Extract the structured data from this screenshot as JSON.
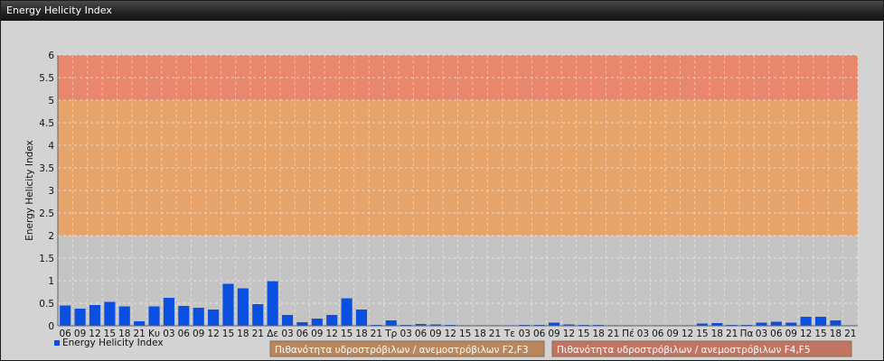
{
  "window": {
    "title": "Energy Helicity Index"
  },
  "chart_data": {
    "type": "bar",
    "ylabel": "Energy Helicity Index",
    "ylim": [
      0,
      6
    ],
    "y_ticks": [
      "0",
      "0.5",
      "1",
      "1.5",
      "2",
      "2.5",
      "3",
      "3.5",
      "4",
      "4.5",
      "5",
      "5.5",
      "6"
    ],
    "grid": true,
    "categories": [
      "06",
      "09",
      "12",
      "15",
      "18",
      "21",
      "Κυ",
      "03",
      "06",
      "09",
      "12",
      "15",
      "18",
      "21",
      "Δε",
      "03",
      "06",
      "09",
      "12",
      "15",
      "18",
      "21",
      "Τρ",
      "03",
      "06",
      "09",
      "12",
      "15",
      "18",
      "21",
      "Τε",
      "03",
      "06",
      "09",
      "12",
      "15",
      "18",
      "21",
      "Πέ",
      "03",
      "06",
      "09",
      "12",
      "15",
      "18",
      "21",
      "Πα",
      "03",
      "06",
      "09",
      "12",
      "15",
      "18",
      "21"
    ],
    "series": [
      {
        "name": "Energy Helicity Index",
        "values": [
          0.45,
          0.38,
          0.46,
          0.53,
          0.43,
          0.1,
          0.43,
          0.62,
          0.44,
          0.4,
          0.36,
          0.93,
          0.83,
          0.48,
          0.99,
          0.24,
          0.08,
          0.16,
          0.24,
          0.61,
          0.36,
          0.02,
          0.12,
          0.02,
          0.04,
          0.03,
          0.02,
          0.01,
          0.01,
          0.01,
          0.01,
          0.02,
          0.02,
          0.07,
          0.03,
          0.02,
          0.02,
          0.01,
          0.01,
          0.01,
          0.01,
          0.01,
          0.01,
          0.05,
          0.06,
          0.02,
          0.02,
          0.07,
          0.09,
          0.07,
          0.2,
          0.2,
          0.12,
          0.01
        ],
        "color": "#0a4fe0"
      }
    ],
    "bands": [
      {
        "from": 2,
        "to": 5,
        "color": "#e6a36a"
      },
      {
        "from": 5,
        "to": 6,
        "color": "#e8876c"
      }
    ],
    "legend": [
      {
        "label": "Πιθανότητα υδροστρόβιλων / ανεμοστρόβιλων F2,F3",
        "color": "#b8875e"
      },
      {
        "label": "Πιθανότητα υδροστρόβιλων / ανεμοστρόβιλων F4,F5",
        "color": "#c07563"
      }
    ],
    "legend_position": "bottom"
  }
}
